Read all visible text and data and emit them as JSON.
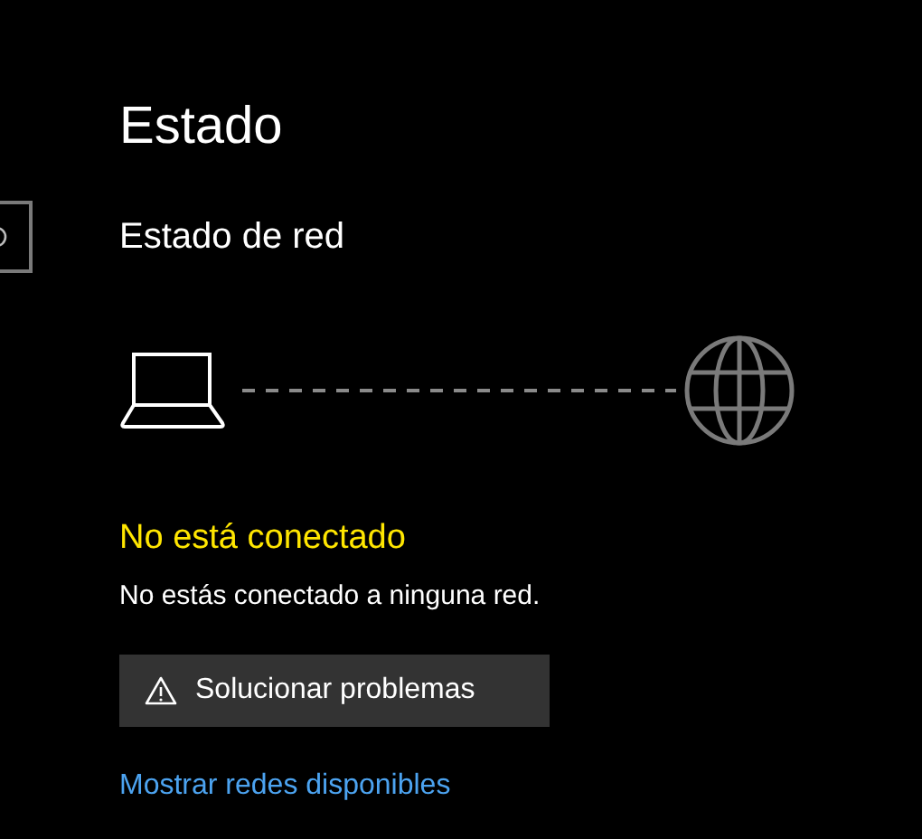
{
  "page_title": "Estado",
  "section_title": "Estado de red",
  "network": {
    "connected": false,
    "headline": "No está conectado",
    "message": "No estás conectado a ninguna red."
  },
  "troubleshoot_button": {
    "label": "Solucionar problemas"
  },
  "link": "Mostrar redes disponibles"
}
